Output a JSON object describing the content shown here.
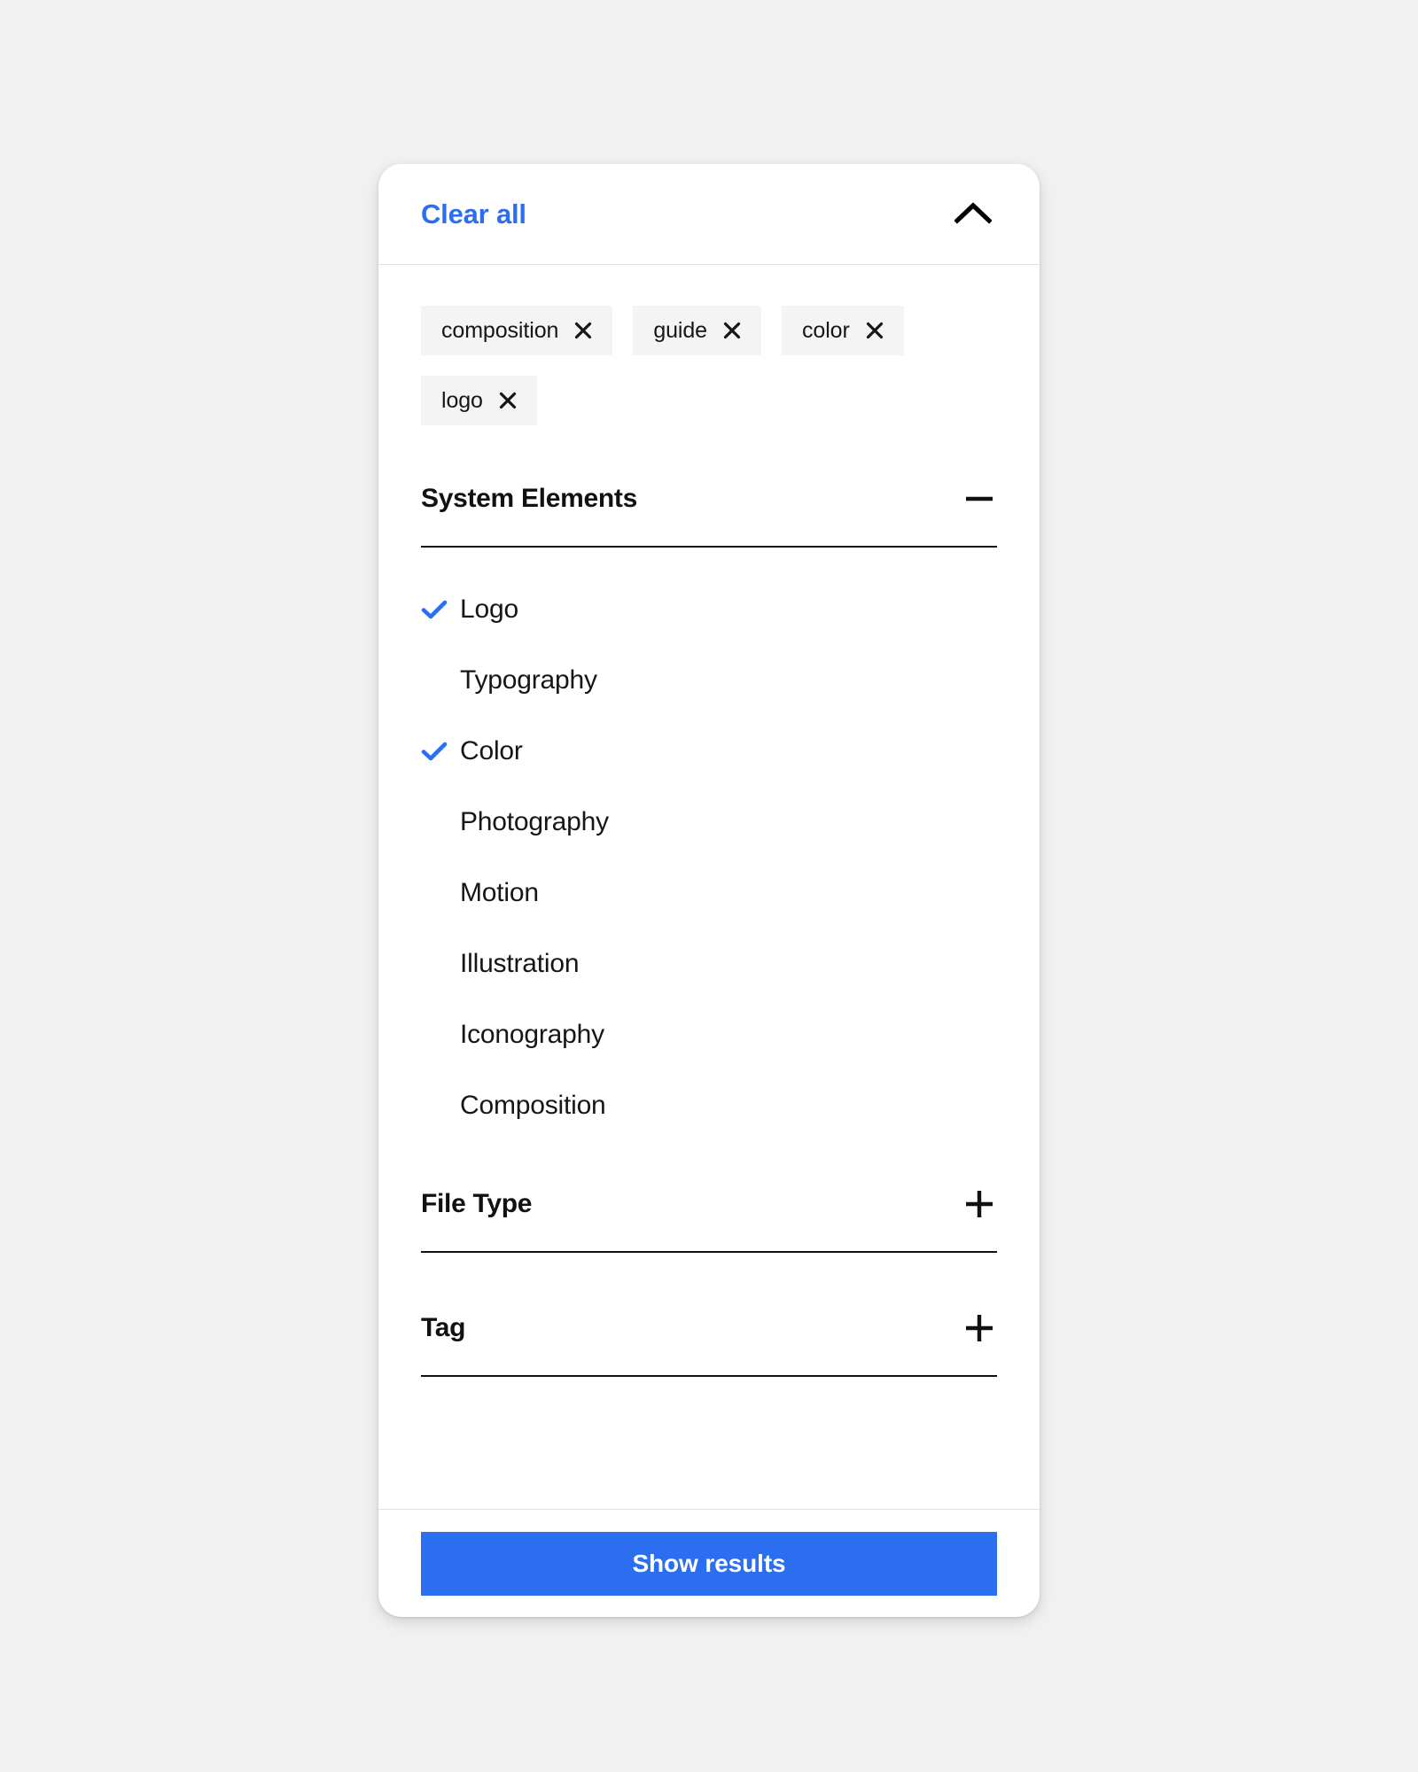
{
  "header": {
    "clear_all_label": "Clear all",
    "collapse_icon": "chevron-up-icon"
  },
  "chips": [
    {
      "label": "composition",
      "remove_icon": "close-icon"
    },
    {
      "label": "guide",
      "remove_icon": "close-icon"
    },
    {
      "label": "color",
      "remove_icon": "close-icon"
    },
    {
      "label": "logo",
      "remove_icon": "close-icon"
    }
  ],
  "sections": [
    {
      "title": "System Elements",
      "expanded": true,
      "toggle_icon": "minus-icon",
      "options": [
        {
          "label": "Logo",
          "checked": true
        },
        {
          "label": "Typography",
          "checked": false
        },
        {
          "label": "Color",
          "checked": true
        },
        {
          "label": "Photography",
          "checked": false
        },
        {
          "label": "Motion",
          "checked": false
        },
        {
          "label": "Illustration",
          "checked": false
        },
        {
          "label": "Iconography",
          "checked": false
        },
        {
          "label": "Composition",
          "checked": false
        }
      ]
    },
    {
      "title": "File Type",
      "expanded": false,
      "toggle_icon": "plus-icon",
      "options": []
    },
    {
      "title": "Tag",
      "expanded": false,
      "toggle_icon": "plus-icon",
      "options": []
    }
  ],
  "footer": {
    "show_results_label": "Show results"
  },
  "colors": {
    "accent": "#2b6ef0",
    "page_background": "#f1f1f1",
    "card_background": "#ffffff",
    "chip_background": "#f4f4f4",
    "text": "#161616",
    "divider": "#e3e3e3",
    "rule": "#111111"
  }
}
